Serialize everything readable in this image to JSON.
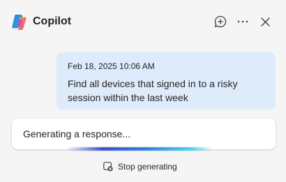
{
  "header": {
    "title": "Copilot",
    "icons": {
      "logo": "copilot-logo",
      "new_chat": "chat-add-icon",
      "more": "more-icon",
      "close": "close-icon"
    }
  },
  "conversation": {
    "user_message": {
      "timestamp": "Feb 18, 2025 10:06 AM",
      "text": "Find all devices that signed in to a risky session within the last week"
    },
    "status": {
      "text": "Generating a response..."
    }
  },
  "stop_button": {
    "label": "Stop generating",
    "icon": "stop-icon"
  },
  "colors": {
    "background": "#f5f5f5",
    "user_bubble": "#deebfb",
    "card": "#ffffff",
    "text": "#242424",
    "progress_start": "#3a4fc8",
    "progress_end": "#4fd0ee"
  }
}
